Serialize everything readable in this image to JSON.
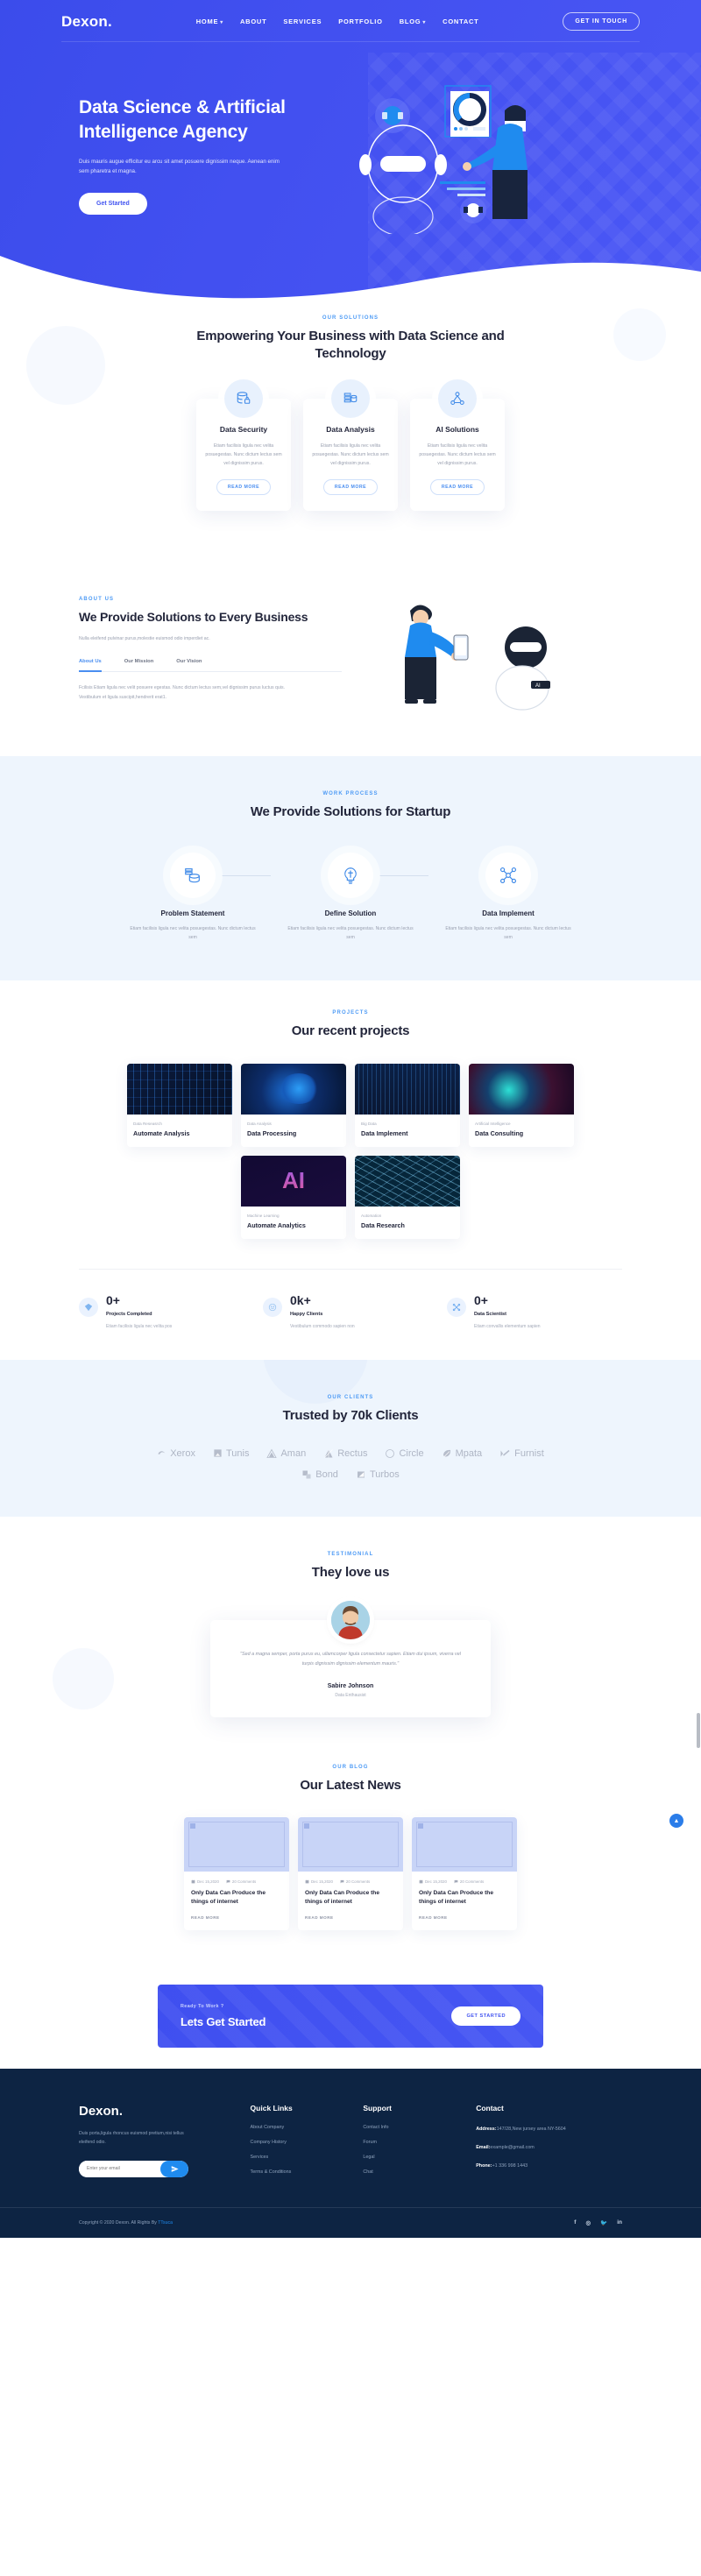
{
  "brand": {
    "name": "Dexon."
  },
  "nav": {
    "items": [
      {
        "label": "HOME",
        "has_dropdown": true
      },
      {
        "label": "ABOUT",
        "has_dropdown": false
      },
      {
        "label": "SERVICES",
        "has_dropdown": false
      },
      {
        "label": "PORTFOLIO",
        "has_dropdown": false
      },
      {
        "label": "BLOG",
        "has_dropdown": true
      },
      {
        "label": "CONTACT",
        "has_dropdown": false
      }
    ],
    "cta": "GET IN TOUCH"
  },
  "hero": {
    "title": "Data Science & Artificial Intelligence Agency",
    "subtitle": "Duis mauris augue efficitur eu arcu sit amet posuere dignissim neque. Aenean enim sem pharetra et magna.",
    "button": "Get Started"
  },
  "solutions": {
    "eyebrow": "OUR SOLUTIONS",
    "title": "Empowering Your Business with Data Science and Technology",
    "cards": [
      {
        "icon": "database-lock-icon",
        "title": "Data Security",
        "text": "Etiam facilisis ligula nec velita posuegestas. Nunc dictum lectus sem vel dignissim purus.",
        "button": "READ MORE"
      },
      {
        "icon": "data-stack-icon",
        "title": "Data Analysis",
        "text": "Etiam facilisis ligula nec velita posuegestas. Nunc dictum lectus sem vel dignissim purus.",
        "button": "READ MORE"
      },
      {
        "icon": "network-nodes-icon",
        "title": "AI Solutions",
        "text": "Etiam facilisis ligula nec velita posuegestas. Nunc dictum lectus sem vel dignissim purus.",
        "button": "READ MORE"
      }
    ]
  },
  "about": {
    "eyebrow": "ABOUT US",
    "title": "We Provide Solutions to Every Business",
    "lead": "Nulla eleifend pulvinar purus,molestie euismod odio imperdiet ac.",
    "tabs": [
      {
        "label": "About Us",
        "active": true
      },
      {
        "label": "Our Mission",
        "active": false
      },
      {
        "label": "Our Vision",
        "active": false
      }
    ],
    "tab_body": "Fcilisis Etiam ligula nec velit posuere egestas. Nunc dictum lectus sem,vel dignissim purus luctus quis. Vestibulum et ligula suscipit,hendrerit erat1."
  },
  "work": {
    "eyebrow": "WORK PROCESS",
    "title": "We Provide Solutions for Startup",
    "steps": [
      {
        "icon": "database-stack-icon",
        "title": "Problem Statement",
        "text": "Etiam facilisis ligula nec velita posuegestas. Nunc dictum lectus sem"
      },
      {
        "icon": "lightbulb-idea-icon",
        "title": "Define Solution",
        "text": "Etiam facilisis ligula nec velita posuegestas. Nunc dictum lectus sem"
      },
      {
        "icon": "data-network-icon",
        "title": "Data Implement",
        "text": "Etiam facilisis ligula nec velita posuegestas. Nunc dictum lectus sem"
      }
    ]
  },
  "projects": {
    "eyebrow": "PROJECTS",
    "title": "Our recent projects",
    "items": [
      {
        "category": "Data Reseasrch",
        "title": "Automate Analysis"
      },
      {
        "category": "Data Analysis",
        "title": "Data Processing"
      },
      {
        "category": "Big Data",
        "title": "Data Implement"
      },
      {
        "category": "Artificial Intelligence",
        "title": "Data Consulting"
      },
      {
        "category": "Machine Learning",
        "title": "Automate Analytics"
      },
      {
        "category": "Automation",
        "title": "Data Research"
      }
    ]
  },
  "counters": [
    {
      "icon": "diamond-icon",
      "number": "0+",
      "label": "Projects Completed",
      "text": "Etiam facilisis ligula nec velita pos"
    },
    {
      "icon": "smile-icon",
      "number": "0k+",
      "label": "Happy Clients",
      "text": "Vestibulum commodo sapien non"
    },
    {
      "icon": "node-icon",
      "number": "0+",
      "label": "Data Scientist",
      "text": "Etiam convallis elementum sapien"
    }
  ],
  "clients": {
    "eyebrow": "OUR CLIENTS",
    "title": "Trusted by 70k Clients",
    "logos": [
      {
        "name": "Xerox",
        "icon": "swirl-mark-icon"
      },
      {
        "name": "Tunis",
        "icon": "square-mark-icon"
      },
      {
        "name": "Aman",
        "icon": "triangle-mark-icon"
      },
      {
        "name": "Rectus",
        "icon": "peak-mark-icon"
      },
      {
        "name": "Circle",
        "icon": "circle-mark-icon"
      },
      {
        "name": "Mpata",
        "icon": "leaf-mark-icon"
      },
      {
        "name": "Furnist",
        "icon": "check-mark-icon"
      },
      {
        "name": "Bond",
        "icon": "blocks-mark-icon"
      },
      {
        "name": "Turbos",
        "icon": "flag-mark-icon"
      }
    ]
  },
  "testimonial": {
    "eyebrow": "TESTIMONIAL",
    "title": "They love us",
    "quote": "\"Sed a magna semper, porta purus eu, ullamcorper ligula consectetur sapien. Etiam dui ipsum, viverra vel turpis dignissim dignissim elementum mauris.\"",
    "name": "Sabire Johnson",
    "role": "Data Enthausist"
  },
  "blog": {
    "eyebrow": "OUR BLOG",
    "title": "Our Latest News",
    "posts": [
      {
        "date": "Dec 15,2020",
        "comments": "20 Comments",
        "title": "Only Data Can Produce the things of internet",
        "more": "READ MORE"
      },
      {
        "date": "Dec 15,2020",
        "comments": "20 Comments",
        "title": "Only Data Can Produce the things of internet",
        "more": "READ MORE"
      },
      {
        "date": "Dec 15,2020",
        "comments": "20 Comments",
        "title": "Only Data Can Produce the things of internet",
        "more": "READ MORE"
      }
    ]
  },
  "cta": {
    "ready": "Ready To Work ?",
    "title": "Lets Get Started",
    "button": "GET STARTED"
  },
  "footer": {
    "brand": "Dexon.",
    "description": "Duis porta,ligula rhoncus euismod pretium,nisi tellus eleifend odio.",
    "subscribe_placeholder": "Enter your email",
    "quick_links": {
      "heading": "Quick Links",
      "items": [
        "About Company",
        "Company History",
        "Services",
        "Terms & Conditions"
      ]
    },
    "support": {
      "heading": "Support",
      "items": [
        "Contact Info",
        "Forum",
        "Legal",
        "Chat"
      ]
    },
    "contact": {
      "heading": "Contact",
      "address_label": "Address:",
      "address_value": "147/28,New jursey area NY-5604",
      "email_label": "Email:",
      "email_value": "example@gmail.com",
      "phone_label": "Phone:",
      "phone_value": "+1 336 998 1443"
    },
    "copyright_prefix": "Copyright © 2020 Dexon. All Rights By ",
    "copyright_link": "TTsuca",
    "socials": [
      "f",
      "◎",
      "🐦",
      "in"
    ]
  },
  "colors": {
    "primary_blue": "#4254f0",
    "accent_blue": "#4e9bf5",
    "dark_navy": "#0d2443",
    "light_bg": "#eef5fd",
    "heading": "#23263b",
    "muted": "#9aa0b0"
  }
}
